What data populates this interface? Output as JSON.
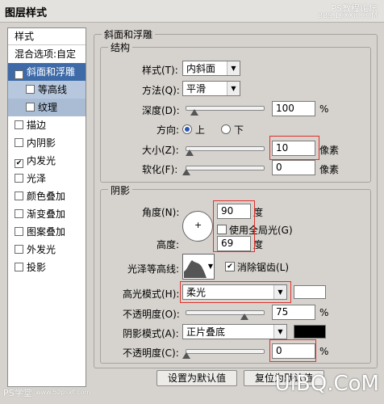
{
  "window": {
    "title": "图层样式"
  },
  "watermark": {
    "top": "PS教程论坛",
    "top_sub": "BBS.16XX8.COM",
    "bl_brand": "PS学堂",
    "bl_site": "www.52psxt.com",
    "br": "UiBQ.CoM"
  },
  "sidebar": {
    "header": "样式",
    "items": [
      {
        "label": "混合选项:自定",
        "checkbox": false,
        "checked": false
      },
      {
        "label": "斜面和浮雕",
        "checkbox": true,
        "checked": true
      },
      {
        "label": "等高线",
        "checkbox": true,
        "checked": false
      },
      {
        "label": "纹理",
        "checkbox": true,
        "checked": false
      },
      {
        "label": "描边",
        "checkbox": true,
        "checked": false
      },
      {
        "label": "内阴影",
        "checkbox": true,
        "checked": false
      },
      {
        "label": "内发光",
        "checkbox": true,
        "checked": true
      },
      {
        "label": "光泽",
        "checkbox": true,
        "checked": false
      },
      {
        "label": "颜色叠加",
        "checkbox": true,
        "checked": false
      },
      {
        "label": "渐变叠加",
        "checkbox": true,
        "checked": false
      },
      {
        "label": "图案叠加",
        "checkbox": true,
        "checked": false
      },
      {
        "label": "外发光",
        "checkbox": true,
        "checked": false
      },
      {
        "label": "投影",
        "checkbox": true,
        "checked": false
      }
    ],
    "check_mark": "✔"
  },
  "bevel": {
    "title": "斜面和浮雕",
    "structure": {
      "title": "结构",
      "style_label": "样式(T):",
      "style_value": "内斜面",
      "technique_label": "方法(Q):",
      "technique_value": "平滑",
      "depth_label": "深度(D):",
      "depth_value": "100",
      "depth_unit": "%",
      "depth_level": 0.1,
      "direction_label": "方向:",
      "dir_up": "上",
      "dir_down": "下",
      "size_label": "大小(Z):",
      "size_value": "10",
      "size_unit": "像素",
      "size_level": 0.04,
      "soften_label": "软化(F):",
      "soften_value": "0",
      "soften_unit": "像素",
      "soften_level": 0.0
    },
    "shading": {
      "title": "阴影",
      "angle_label": "角度(N):",
      "angle_value": "90",
      "angle_unit": "度",
      "global_light_label": "使用全局光(G)",
      "altitude_label": "高度:",
      "altitude_value": "69",
      "altitude_unit": "度",
      "gloss_label": "光泽等高线:",
      "antialias_label": "消除锯齿(L)",
      "highlight_label": "高光模式(H):",
      "highlight_value": "柔光",
      "highlight_color": "#ffffff",
      "h_opacity_label": "不透明度(O):",
      "h_opacity_value": "75",
      "h_opacity_unit": "%",
      "h_opacity_level": 0.75,
      "shadow_label": "阴影模式(A):",
      "shadow_value": "正片叠底",
      "shadow_color": "#000000",
      "s_opacity_label": "不透明度(C):",
      "s_opacity_value": "0",
      "s_opacity_unit": "%",
      "s_opacity_level": 0.0
    }
  },
  "buttons": {
    "default": "设置为默认值",
    "reset": "复位为默认值"
  }
}
